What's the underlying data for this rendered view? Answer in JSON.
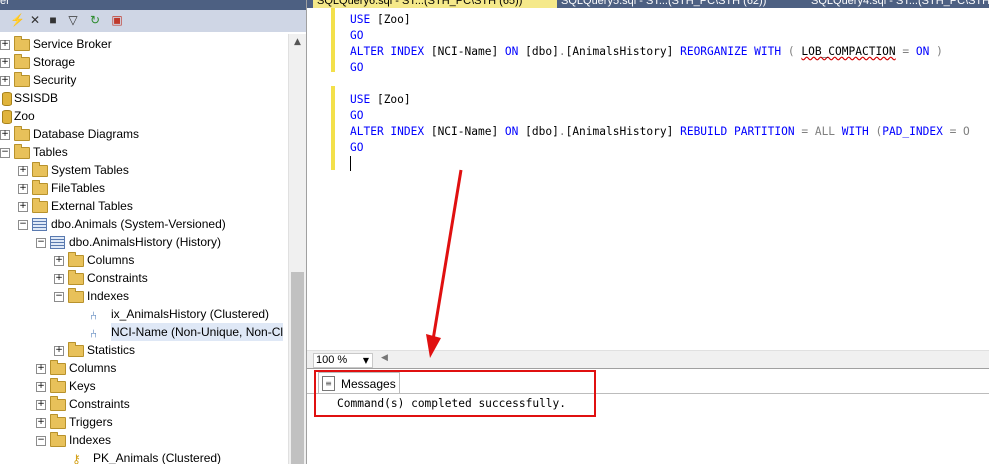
{
  "object_explorer": {
    "header_title": "er",
    "tree": [
      {
        "label": "Service Broker",
        "icon": "folder-icon",
        "state": "collapsed"
      },
      {
        "label": "Storage",
        "icon": "folder-icon",
        "state": "collapsed"
      },
      {
        "label": "Security",
        "icon": "folder-icon",
        "state": "collapsed"
      },
      {
        "label": "SSISDB",
        "icon": "database-icon",
        "state": "none"
      },
      {
        "label": "Zoo",
        "icon": "database-icon",
        "state": "none"
      },
      {
        "label": "Database Diagrams",
        "icon": "folder-icon",
        "state": "collapsed"
      },
      {
        "label": "Tables",
        "icon": "folder-icon",
        "state": "expanded"
      },
      {
        "label": "System Tables",
        "icon": "folder-icon",
        "state": "collapsed"
      },
      {
        "label": "FileTables",
        "icon": "folder-icon",
        "state": "collapsed"
      },
      {
        "label": "External Tables",
        "icon": "folder-icon",
        "state": "collapsed"
      },
      {
        "label": "dbo.Animals (System-Versioned)",
        "icon": "table-icon",
        "state": "expanded"
      },
      {
        "label": "dbo.AnimalsHistory (History)",
        "icon": "history-table-icon",
        "state": "expanded"
      },
      {
        "label": "Columns",
        "icon": "folder-icon",
        "state": "collapsed"
      },
      {
        "label": "Constraints",
        "icon": "folder-icon",
        "state": "collapsed"
      },
      {
        "label": "Indexes",
        "icon": "folder-icon",
        "state": "expanded"
      },
      {
        "label": "ix_AnimalsHistory (Clustered)",
        "icon": "index-icon",
        "state": "none"
      },
      {
        "label": "NCI-Name (Non-Unique, Non-Cl",
        "icon": "index-icon",
        "state": "none"
      },
      {
        "label": "Statistics",
        "icon": "folder-icon",
        "state": "collapsed"
      },
      {
        "label": "Columns",
        "icon": "folder-icon",
        "state": "collapsed"
      },
      {
        "label": "Keys",
        "icon": "folder-icon",
        "state": "collapsed"
      },
      {
        "label": "Constraints",
        "icon": "folder-icon",
        "state": "collapsed"
      },
      {
        "label": "Triggers",
        "icon": "folder-icon",
        "state": "collapsed"
      },
      {
        "label": "Indexes",
        "icon": "folder-icon",
        "state": "expanded"
      },
      {
        "label": "PK_Animals (Clustered)",
        "icon": "key-icon",
        "state": "none"
      }
    ]
  },
  "tabs": [
    {
      "label": "SQLQuery6.sql - ST...(STH_PC\\STH (65))",
      "active": true
    },
    {
      "label": "SQLQuery5.sql - ST...(STH_PC\\STH (62))",
      "active": false
    },
    {
      "label": "SQLQuery4.sql - ST...(STH_PC\\STH",
      "active": false
    }
  ],
  "editor": {
    "lines": [
      [
        {
          "t": "USE ",
          "c": "kw"
        },
        {
          "t": "[Zoo]",
          "c": ""
        }
      ],
      [
        {
          "t": "GO",
          "c": "kw"
        }
      ],
      [
        {
          "t": "ALTER INDEX ",
          "c": "kw"
        },
        {
          "t": "[NCI-Name] ",
          "c": ""
        },
        {
          "t": "ON ",
          "c": "kw"
        },
        {
          "t": "[dbo]",
          "c": ""
        },
        {
          "t": ".",
          "c": "gr"
        },
        {
          "t": "[AnimalsHistory] ",
          "c": ""
        },
        {
          "t": "REORGANIZE WITH ",
          "c": "kw"
        },
        {
          "t": "( ",
          "c": "gr"
        },
        {
          "t": "LOB_COMPACTION",
          "c": "wavy"
        },
        {
          "t": " = ",
          "c": "gr"
        },
        {
          "t": "ON",
          "c": "kw"
        },
        {
          "t": " )",
          "c": "gr"
        }
      ],
      [
        {
          "t": "GO",
          "c": "kw"
        }
      ],
      [],
      [
        {
          "t": "USE ",
          "c": "kw"
        },
        {
          "t": "[Zoo]",
          "c": ""
        }
      ],
      [
        {
          "t": "GO",
          "c": "kw"
        }
      ],
      [
        {
          "t": "ALTER INDEX ",
          "c": "kw"
        },
        {
          "t": "[NCI-Name] ",
          "c": ""
        },
        {
          "t": "ON ",
          "c": "kw"
        },
        {
          "t": "[dbo]",
          "c": ""
        },
        {
          "t": ".",
          "c": "gr"
        },
        {
          "t": "[AnimalsHistory] ",
          "c": ""
        },
        {
          "t": "REBUILD PARTITION ",
          "c": "kw"
        },
        {
          "t": "= ",
          "c": "gr"
        },
        {
          "t": "ALL ",
          "c": "gr"
        },
        {
          "t": "WITH ",
          "c": "kw"
        },
        {
          "t": "(",
          "c": "gr"
        },
        {
          "t": "PAD_INDEX ",
          "c": "kw"
        },
        {
          "t": "= O",
          "c": "gr"
        }
      ],
      [
        {
          "t": "GO",
          "c": "kw"
        }
      ]
    ]
  },
  "zoom": {
    "value": "100 %"
  },
  "results": {
    "tab_label": "Messages",
    "message": "Command(s) completed successfully."
  },
  "colors": {
    "highlight": "#e01010",
    "keyword": "#0000ff",
    "operator": "#808080"
  }
}
